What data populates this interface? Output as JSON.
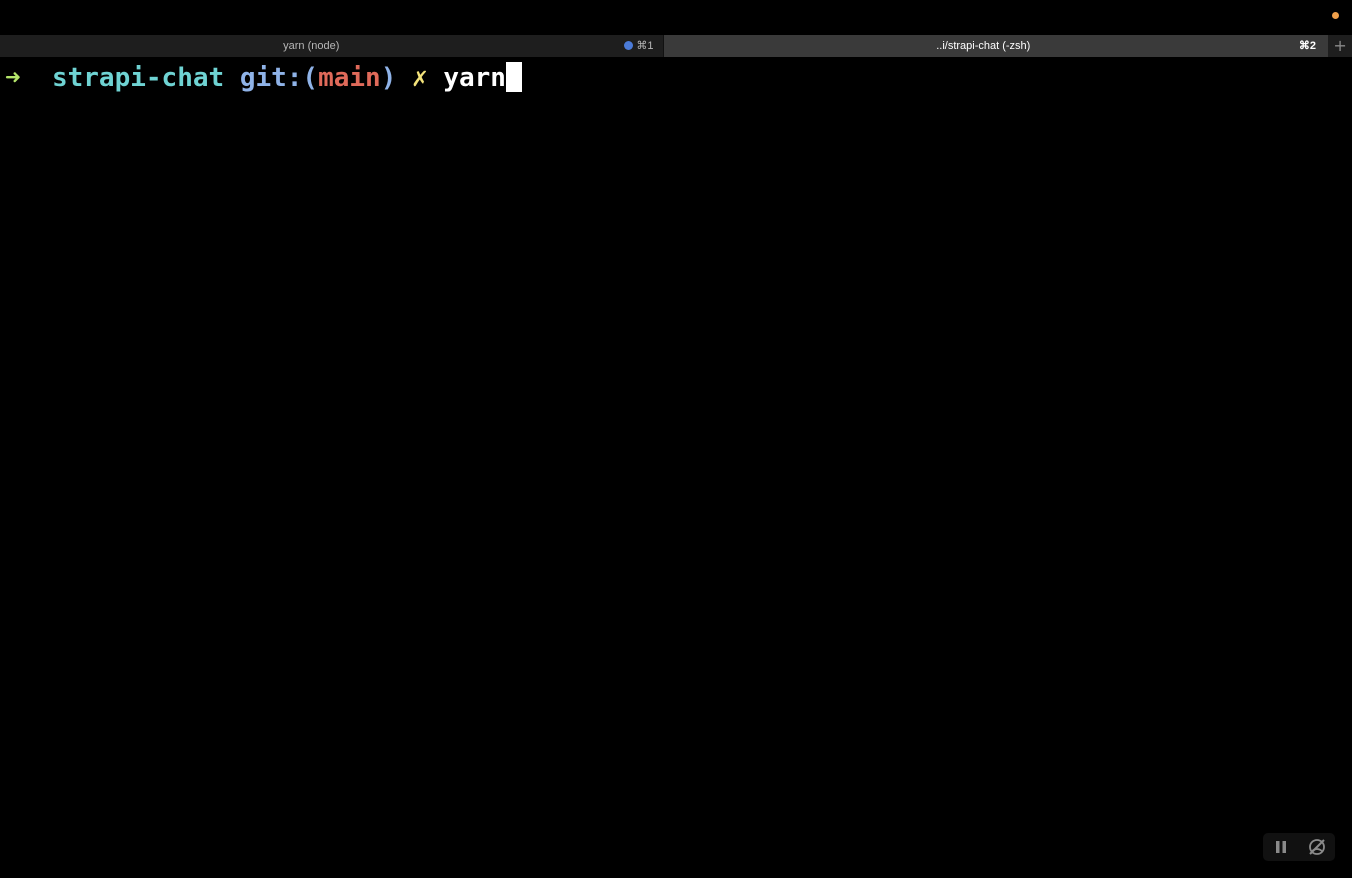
{
  "tabs": [
    {
      "title": "yarn (node)",
      "shortcut": "⌘1",
      "has_activity": true,
      "active": false
    },
    {
      "title": "..i/strapi-chat (-zsh)",
      "shortcut": "⌘2",
      "active": true
    }
  ],
  "new_tab_symbol": "+",
  "prompt": {
    "arrow": "➜",
    "directory": "strapi-chat",
    "git_label": "git:(",
    "branch": "main",
    "git_close": ")",
    "dirty_marker": "✗",
    "command": "yarn"
  },
  "colors": {
    "background": "#000000",
    "arrow": "#b4e56a",
    "directory": "#6fd3d3",
    "git_label": "#8fb3e8",
    "branch": "#e06a5a",
    "dirty": "#f3e27a",
    "activity_dot": "#f0a04b",
    "tab_bell": "#4b7bd8"
  },
  "icons": {
    "activity": "activity-dot-icon",
    "bell": "bell-dot-icon",
    "pause": "pause-icon",
    "no-broadcast": "broadcast-off-icon"
  }
}
